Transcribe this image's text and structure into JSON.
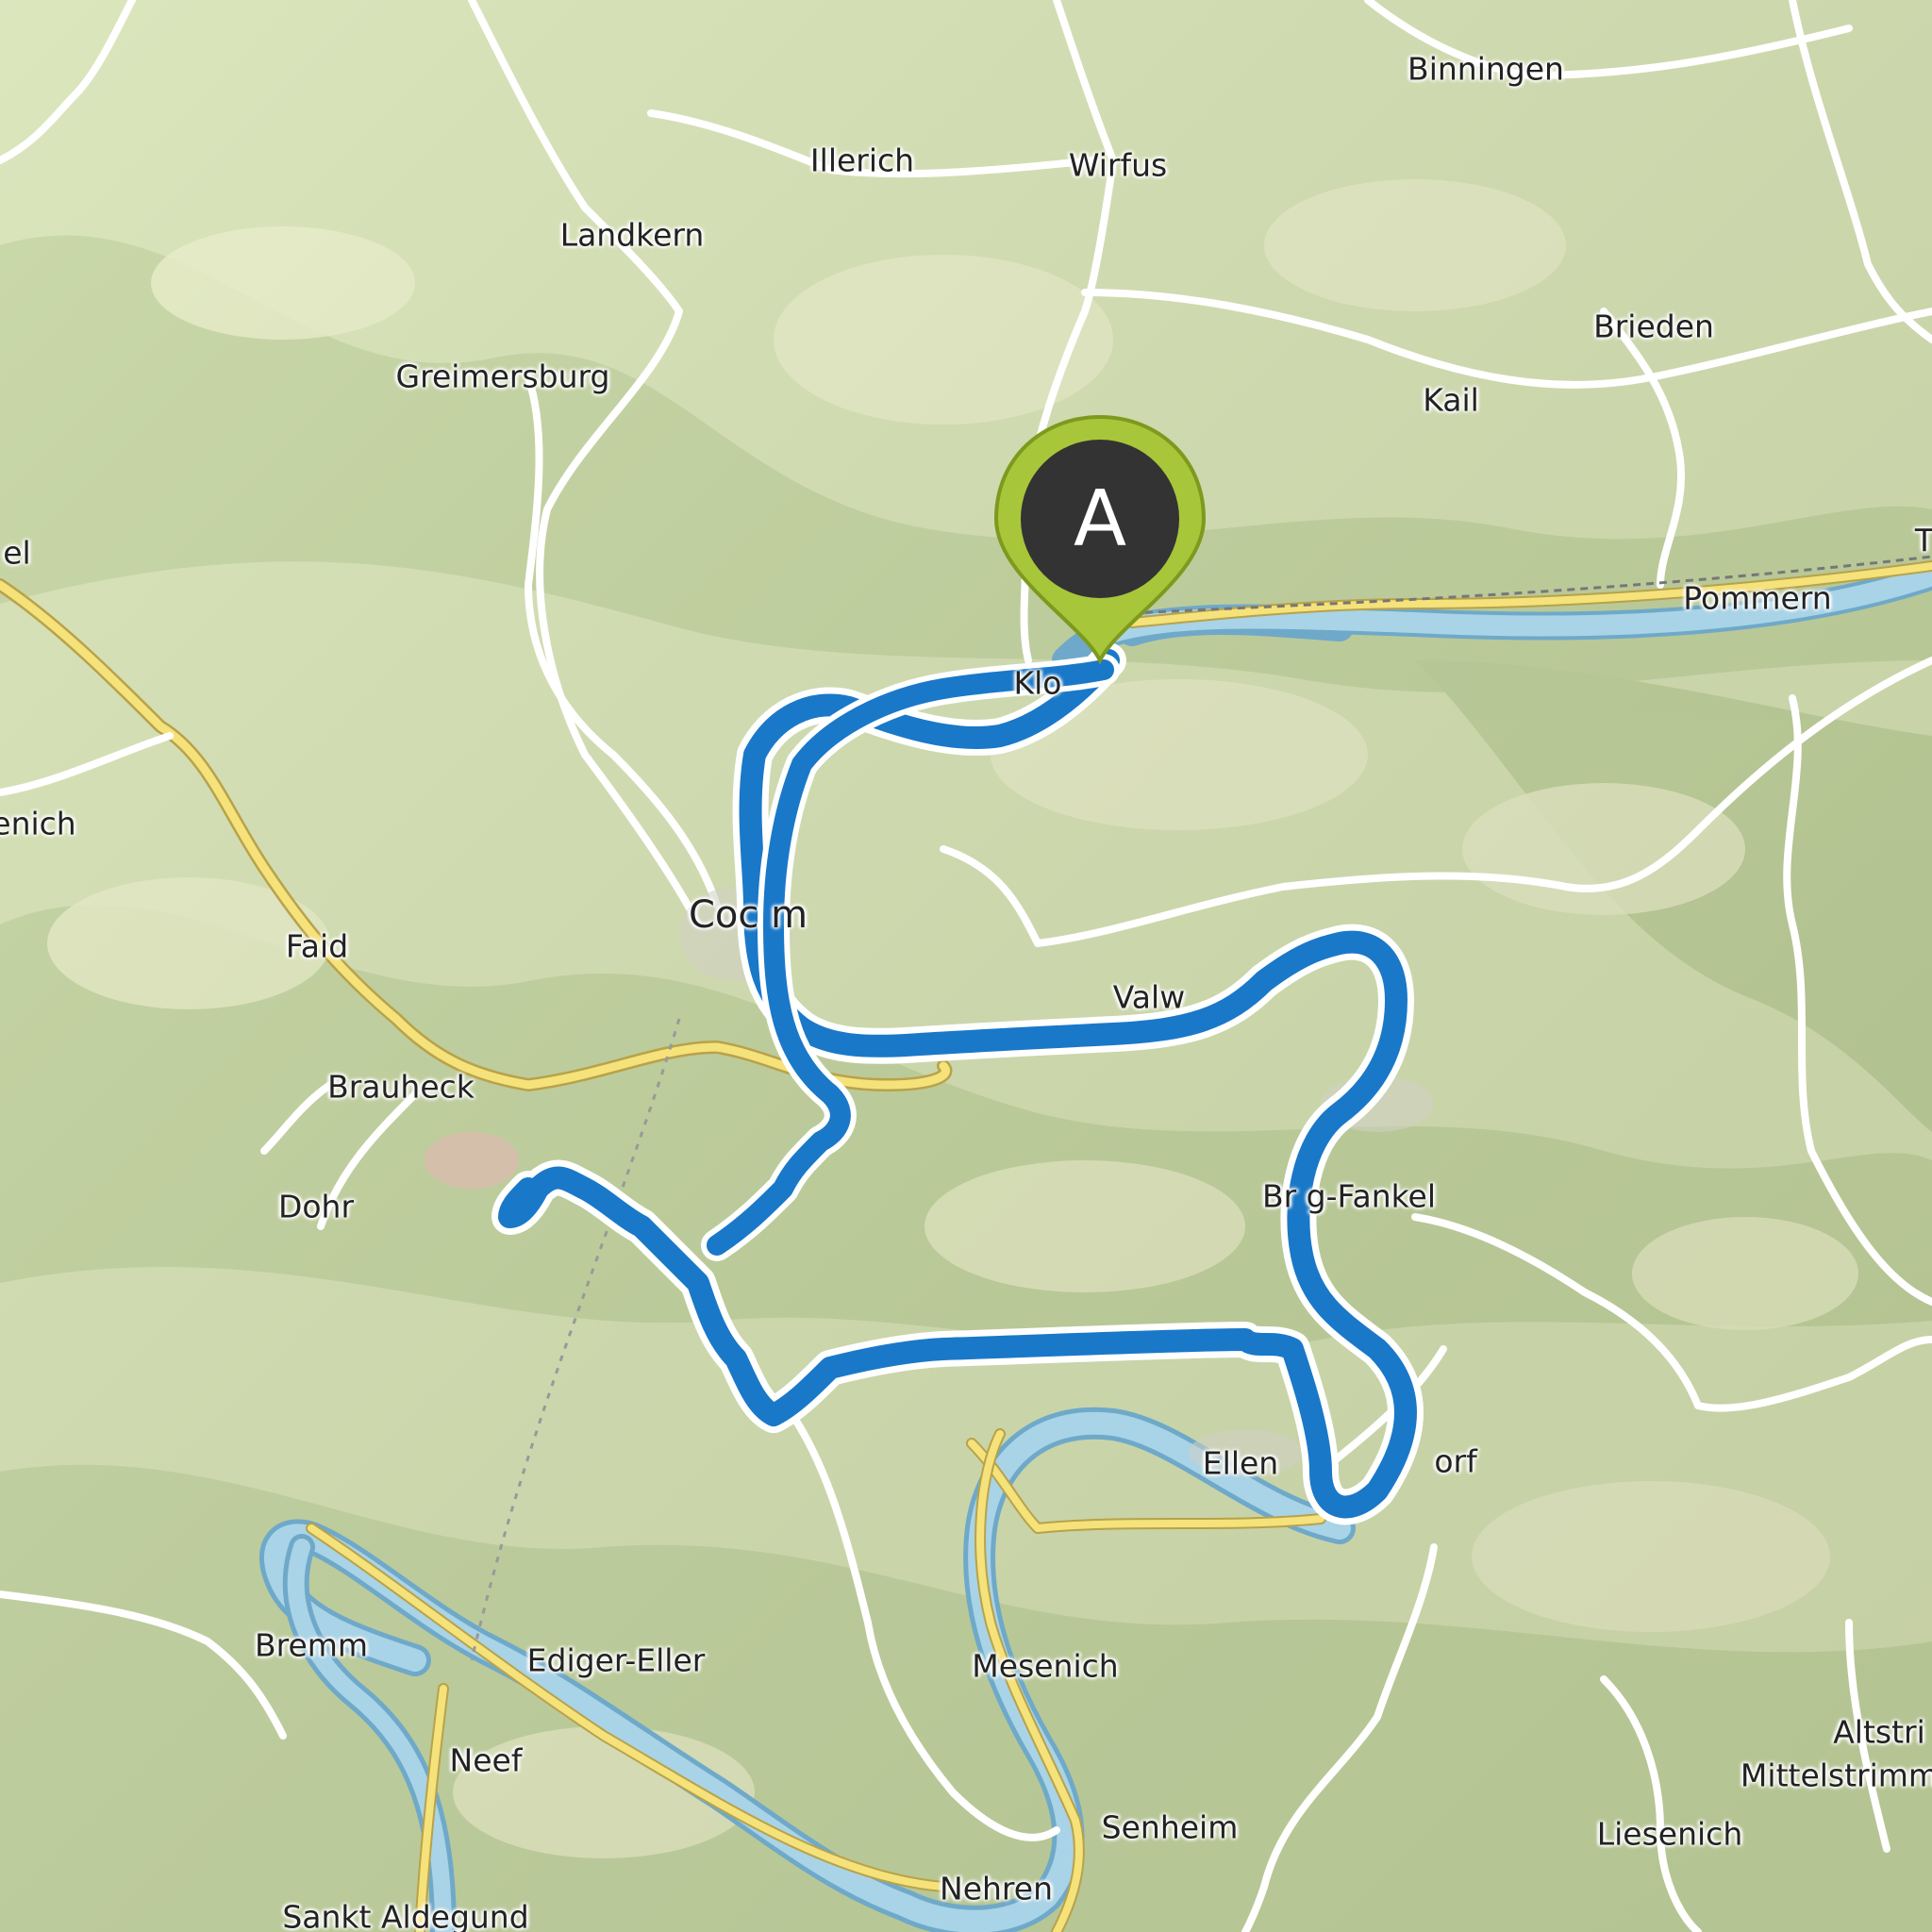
{
  "map": {
    "colors": {
      "background": "#d9e3b8",
      "forest": "#c5d6a0",
      "forest_dark": "#a9bf85",
      "field": "#eef0cf",
      "river": "#a9d3e6",
      "river_edge": "#6fa9c9",
      "road_major": "#f5e27a",
      "road_minor": "#ffffff",
      "route": "#1a78c8",
      "marker": "#a8c63a",
      "marker_inner": "#333333"
    },
    "start_marker": {
      "letter": "A",
      "icon": "map-pin-icon"
    },
    "places": [
      {
        "id": "binningen",
        "name": "Binningen"
      },
      {
        "id": "illerich",
        "name": "Illerich"
      },
      {
        "id": "wirfus",
        "name": "Wirfus"
      },
      {
        "id": "landkern",
        "name": "Landkern"
      },
      {
        "id": "brieden",
        "name": "Brieden"
      },
      {
        "id": "greimersburg",
        "name": "Greimersburg"
      },
      {
        "id": "kail",
        "name": "Kail"
      },
      {
        "id": "el",
        "name": "el"
      },
      {
        "id": "t",
        "name": "T"
      },
      {
        "id": "pommern",
        "name": "Pommern"
      },
      {
        "id": "klotten",
        "name": "Klo"
      },
      {
        "id": "enich",
        "name": "enich"
      },
      {
        "id": "cochem",
        "name": "Coc    m"
      },
      {
        "id": "faid",
        "name": "Faid"
      },
      {
        "id": "valwig",
        "name": "Valw"
      },
      {
        "id": "brauheck",
        "name": "Brauheck"
      },
      {
        "id": "dohr",
        "name": "Dohr"
      },
      {
        "id": "bruttig",
        "name": "Br      g-Fankel"
      },
      {
        "id": "ellenz",
        "name": "Ellen"
      },
      {
        "id": "ellenz_end",
        "name": "orf"
      },
      {
        "id": "bremm",
        "name": "Bremm"
      },
      {
        "id": "ediger",
        "name": "Ediger-Eller"
      },
      {
        "id": "mesenich",
        "name": "Mesenich"
      },
      {
        "id": "neef",
        "name": "Neef"
      },
      {
        "id": "senheim",
        "name": "Senheim"
      },
      {
        "id": "nehren",
        "name": "Nehren"
      },
      {
        "id": "sankt_aldegund",
        "name": "Sankt Aldegund"
      },
      {
        "id": "altstrimmig",
        "name": "Altstri"
      },
      {
        "id": "mittelstrimmig",
        "name": "Mittelstrimm"
      },
      {
        "id": "liesenich",
        "name": "Liesenich"
      }
    ]
  }
}
